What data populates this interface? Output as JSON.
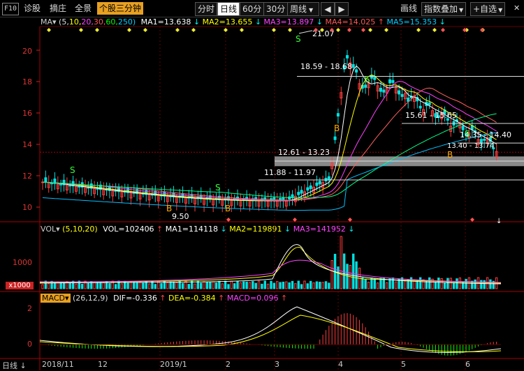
{
  "toolbar": {
    "f10": "F10",
    "left_tabs": [
      "诊股",
      "摘庄",
      "全景"
    ],
    "active_tab": "个股三分钟",
    "periods": [
      "分时",
      "日线",
      "60分",
      "30分"
    ],
    "selected_period": "日线",
    "week_select": "周线",
    "draw": "画线",
    "index_overlay": "指数叠加",
    "add_self": "+自选"
  },
  "ma_bar": {
    "label": "MA",
    "params_prefix": "(5,",
    "p10": "10,",
    "p20": "20,",
    "p30": "30,",
    "p60": "60,",
    "p250": "250)",
    "ma1": "MA1=13.638",
    "ma2": "MA2=13.655",
    "ma3": "MA3=13.897",
    "ma4": "MA4=14.025",
    "ma5": "MA5=15.353"
  },
  "vol_bar": {
    "label": "VOL",
    "params": "(5,10,20)",
    "vol": "VOL=102406",
    "ma1": "MA1=114118",
    "ma2": "MA2=119891",
    "ma3": "MA3=141952"
  },
  "macd_bar": {
    "label": "MACD",
    "params": "(26,12,9)",
    "dif": "DIF=-0.336",
    "dea": "DEA=-0.384",
    "macd": "MACD=0.096"
  },
  "price_axis": [
    "20",
    "18",
    "16",
    "14",
    "12",
    "10"
  ],
  "vol_axis": [
    "1000",
    "x1000"
  ],
  "macd_axis": [
    "2",
    "0"
  ],
  "annotations": {
    "high": "21.07",
    "low": "9.50",
    "band1": "18.59 - 18.68",
    "band2": "15.61 - 15.65",
    "band3": "14.35 - 14.40",
    "band4": "12.61 - 13.23",
    "band5": "11.88 - 11.97",
    "band6": "13.40 - 13.74"
  },
  "signals": {
    "buy": "B",
    "sell": "S"
  },
  "x_axis": {
    "left_label": "日线",
    "dates": [
      "2018/11",
      "12",
      "2019/1",
      "2",
      "3",
      "4",
      "5",
      "6"
    ]
  },
  "colors": {
    "up": "#ff3c3c",
    "down": "#00e0e0",
    "ma5": "#ffffff",
    "ma10": "#ffff00",
    "ma20": "#ff40ff",
    "ma30": "#ff6060",
    "ma60": "#00ff00",
    "ma250": "#00c0ff"
  }
}
